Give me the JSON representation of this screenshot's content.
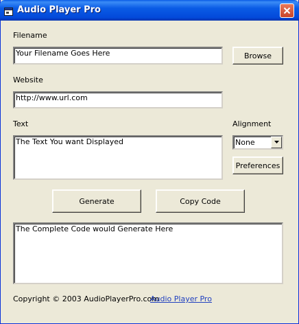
{
  "window": {
    "title": "Audio Player Pro"
  },
  "filename": {
    "label": "Filename",
    "value": "Your Filename Goes Here",
    "browse_label": "Browse"
  },
  "website": {
    "label": "Website",
    "value": "http://www.url.com"
  },
  "text": {
    "label": "Text",
    "value": "The Text You want Displayed"
  },
  "alignment": {
    "label": "Alignment",
    "selected": "None",
    "preferences_label": "Preferences"
  },
  "actions": {
    "generate_label": "Generate",
    "copy_label": "Copy Code"
  },
  "output": {
    "value": "The Complete Code would Generate Here"
  },
  "footer": {
    "copyright": "Copyright © 2003  AudioPlayerPro.com",
    "link": "Audio Player Pro"
  }
}
